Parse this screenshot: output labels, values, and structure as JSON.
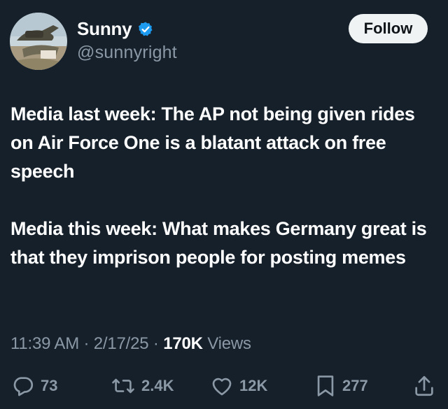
{
  "author": {
    "name": "Sunny",
    "handle": "@sunnyright",
    "verified": true
  },
  "follow_label": "Follow",
  "tweet": {
    "paragraphs": [
      "Media last week: The AP not being given rides on Air Force One is a blatant attack on free speech",
      "Media this week: What makes Germany great is that they imprison people for posting memes"
    ]
  },
  "meta": {
    "time": "11:39 AM",
    "sep1": " · ",
    "date": "2/17/25",
    "sep2": " · ",
    "views_count": "170K",
    "views_label": " Views"
  },
  "actions": {
    "replies": "73",
    "reposts": "2.4K",
    "likes": "12K",
    "bookmarks": "277"
  },
  "colors": {
    "background": "#15202b",
    "text": "#ffffff",
    "secondary_text": "#8b98a5",
    "verified": "#1d9bf0",
    "follow_bg": "#eff3f4"
  },
  "icons": {
    "avatar": "avatar-image",
    "verified": "verified-badge-icon",
    "reply": "reply-icon",
    "repost": "repost-icon",
    "like": "heart-icon",
    "bookmark": "bookmark-icon",
    "share": "share-icon"
  }
}
